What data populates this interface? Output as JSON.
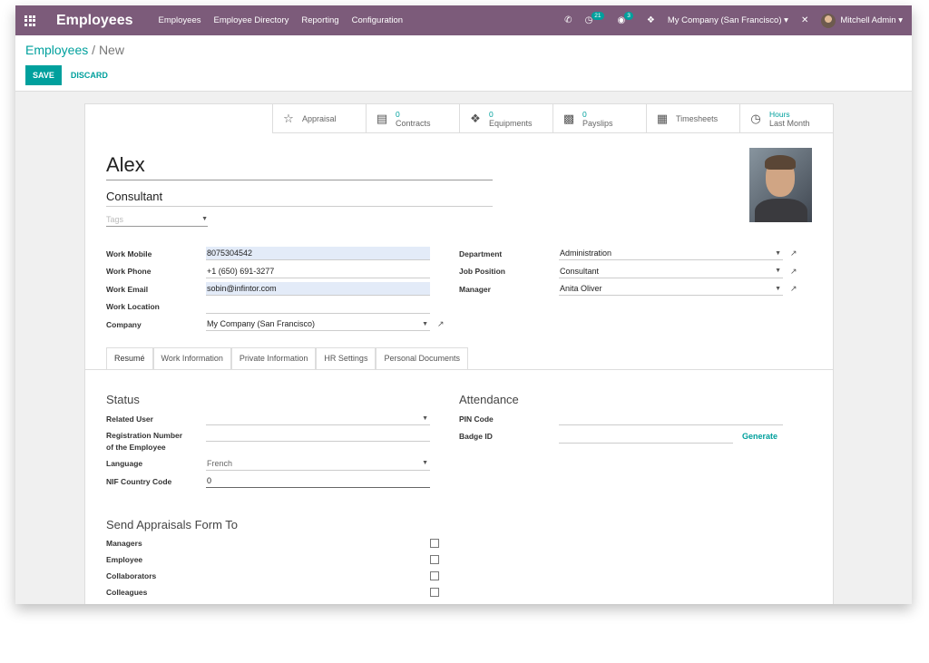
{
  "navbar": {
    "app_name": "Employees",
    "menu": [
      "Employees",
      "Employee Directory",
      "Reporting",
      "Configuration"
    ],
    "activity_count": "21",
    "message_count": "3",
    "company": "My Company (San Francisco)",
    "user": "Mitchell Admin"
  },
  "breadcrumb": {
    "parent": "Employees",
    "separator": "/",
    "current": "New"
  },
  "buttons": {
    "save": "SAVE",
    "discard": "DISCARD"
  },
  "stat_buttons": [
    {
      "value": "",
      "label": "Appraisal",
      "icon": "star-icon"
    },
    {
      "value": "0",
      "label": "Contracts",
      "icon": "book-icon"
    },
    {
      "value": "0",
      "label": "Equipments",
      "icon": "cubes-icon"
    },
    {
      "value": "0",
      "label": "Payslips",
      "icon": "money-icon"
    },
    {
      "value": "",
      "label": "Timesheets",
      "icon": "calendar-icon"
    },
    {
      "value": "Hours",
      "label": "Last Month",
      "icon": "clock-icon"
    }
  ],
  "employee": {
    "name": "Alex",
    "job_title": "Consultant",
    "tags_placeholder": "Tags"
  },
  "left_fields": [
    {
      "label": "Work Mobile",
      "value": "8075304542"
    },
    {
      "label": "Work Phone",
      "value": "+1 (650) 691-3277"
    },
    {
      "label": "Work Email",
      "value": "sobin@infintor.com"
    },
    {
      "label": "Work Location",
      "value": ""
    },
    {
      "label": "Company",
      "value": "My Company (San Francisco)"
    }
  ],
  "right_fields": [
    {
      "label": "Department",
      "value": "Administration"
    },
    {
      "label": "Job Position",
      "value": "Consultant"
    },
    {
      "label": "Manager",
      "value": "Anita Oliver"
    }
  ],
  "tabs": [
    "Resumé",
    "Work Information",
    "Private Information",
    "HR Settings",
    "Personal Documents"
  ],
  "hr_settings": {
    "status_title": "Status",
    "related_user_label": "Related User",
    "related_user_value": "",
    "registration_label_1": "Registration Number",
    "registration_label_2": "of the Employee",
    "registration_value": "",
    "language_label": "Language",
    "language_value": "French",
    "nif_label": "NIF Country Code",
    "nif_value": "0",
    "attendance_title": "Attendance",
    "pin_label": "PIN Code",
    "pin_value": "",
    "badge_label": "Badge ID",
    "badge_value": "",
    "generate": "Generate",
    "appraisal_title": "Send Appraisals Form To",
    "appraisal_options": [
      "Managers",
      "Employee",
      "Collaborators",
      "Colleagues"
    ]
  },
  "colors": {
    "navbar": "#7c5b7a",
    "accent": "#00a09d"
  }
}
